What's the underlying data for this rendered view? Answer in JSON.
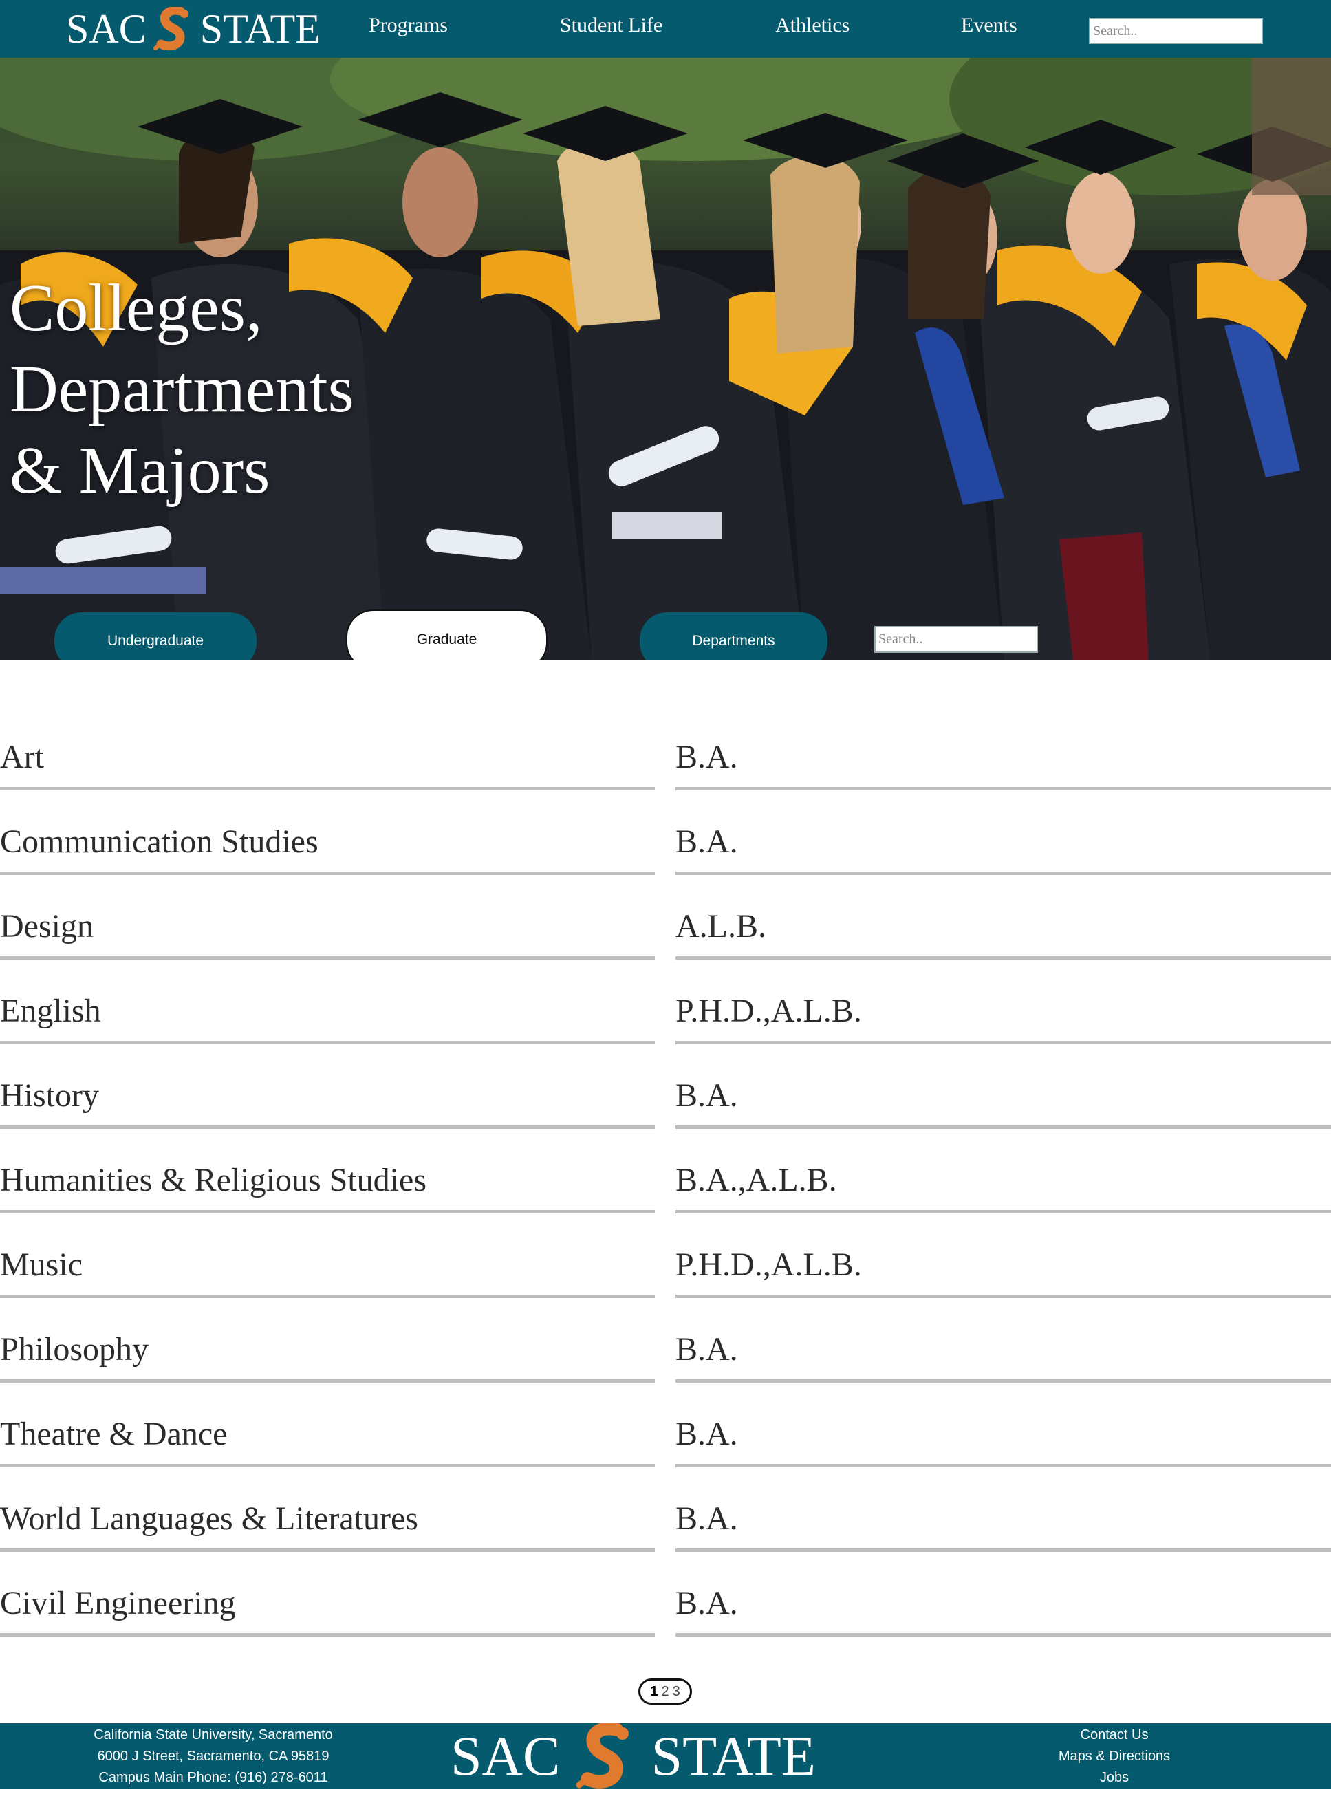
{
  "header": {
    "logo_left": "SAC",
    "logo_right": "STATE",
    "nav": [
      "Programs",
      "Student Life",
      "Athletics",
      "Events"
    ],
    "search_placeholder": "Search.."
  },
  "hero": {
    "title_lines": [
      "Colleges,",
      "Departments",
      "& Majors"
    ],
    "tabs": [
      "Undergraduate",
      "Graduate",
      "Departments"
    ],
    "active_tab": "Graduate",
    "search_placeholder": "Search.."
  },
  "programs": [
    {
      "name": "Art",
      "degree": "B.A."
    },
    {
      "name": "Communication Studies",
      "degree": "B.A."
    },
    {
      "name": "Design",
      "degree": "A.L.B."
    },
    {
      "name": "English",
      "degree": "P.H.D.,A.L.B."
    },
    {
      "name": "History",
      "degree": "B.A."
    },
    {
      "name": "Humanities & Religious Studies",
      "degree": "B.A.,A.L.B."
    },
    {
      "name": "Music",
      "degree": "P.H.D.,A.L.B."
    },
    {
      "name": "Philosophy",
      "degree": "B.A."
    },
    {
      "name": "Theatre & Dance",
      "degree": "B.A."
    },
    {
      "name": "World Languages & Literatures",
      "degree": "B.A."
    },
    {
      "name": "Civil Engineering",
      "degree": "B.A."
    }
  ],
  "pagination": {
    "pages": [
      "1",
      "2",
      "3"
    ],
    "current": "1"
  },
  "footer": {
    "address": [
      "California State University, Sacramento",
      "6000 J Street, Sacramento, CA 95819",
      "Campus Main Phone: (916) 278-6011"
    ],
    "logo_left": "SAC",
    "logo_right": "STATE",
    "links": [
      "Contact Us",
      "Maps & Directions",
      "Jobs"
    ]
  },
  "colors": {
    "brand_teal": "#065a6e",
    "brand_orange": "#e07a2e",
    "rule_gray": "#bdbdbd"
  },
  "icons": {
    "logo_mark": "hornet-s-icon"
  }
}
